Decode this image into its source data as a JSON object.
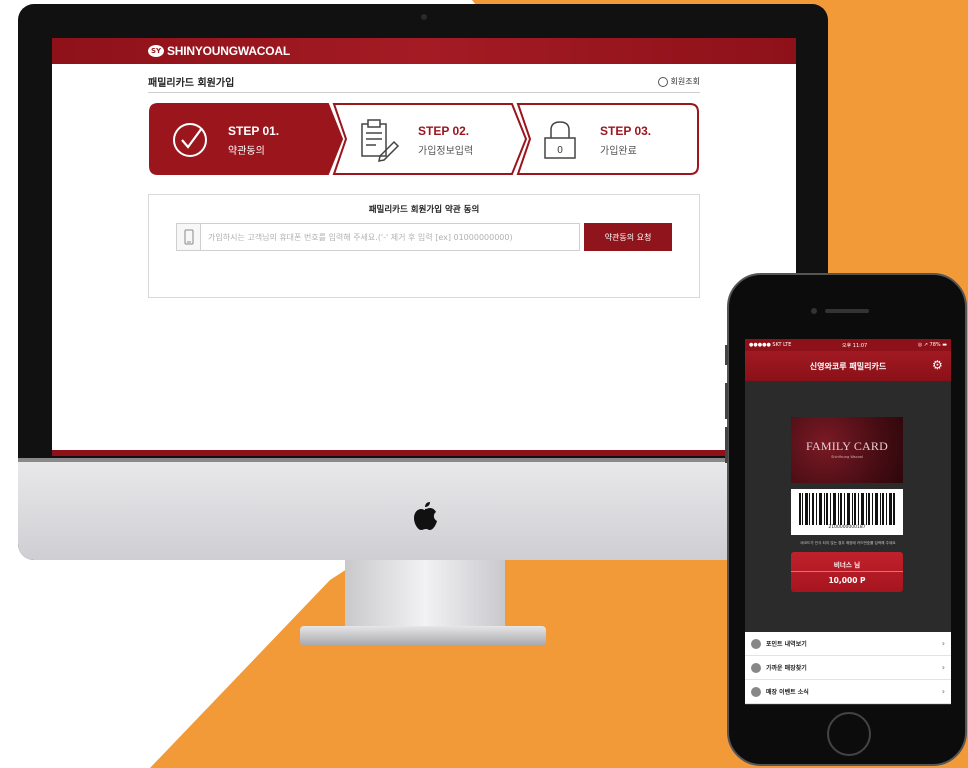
{
  "colors": {
    "orange": "#f29a38",
    "brand_red": "#8f141c",
    "header_red": "#a41b24"
  },
  "site": {
    "logo_mark": "SY",
    "logo_text": "SHINYOUNGWACOAL",
    "page_title": "패밀리카드 회원가입",
    "member_lookup_label": "회원조회"
  },
  "steps": [
    {
      "label": "STEP 01.",
      "desc": "약관동의",
      "icon": "check-circle-icon",
      "active": true
    },
    {
      "label": "STEP 02.",
      "desc": "가입정보입력",
      "icon": "clipboard-pen-icon",
      "active": false
    },
    {
      "label": "STEP 03.",
      "desc": "가입완료",
      "icon": "lock-icon",
      "active": false
    }
  ],
  "terms": {
    "title": "패밀리카드 회원가입 약관 동의",
    "phone_placeholder": "가입하시는 고객님의 휴대폰 번호를 입력해 주세요.('-' 제거 후 입력 [ex] 01000000000)",
    "request_button": "약관동의 요청"
  },
  "app": {
    "status_left": "●●●●● SKT LTE",
    "status_time": "오후 11:07",
    "status_right": "◎ ↗ 78% ▬",
    "title": "신영와코루 패밀리카드",
    "card_title": "FAMILY CARD",
    "card_subtitle": "ShinYoung Wacoal",
    "barcode_number": "2100000000187",
    "barcode_note": "바코드가 인식 되지 않는 경우 매장에 카드번호를 입력해 주세요",
    "member_name": "비너스 님",
    "points": "10,000 P",
    "menu": [
      {
        "label": "포인트 내역보기"
      },
      {
        "label": "가까운 매장찾기"
      },
      {
        "label": "매장 이벤트 소식"
      }
    ]
  }
}
